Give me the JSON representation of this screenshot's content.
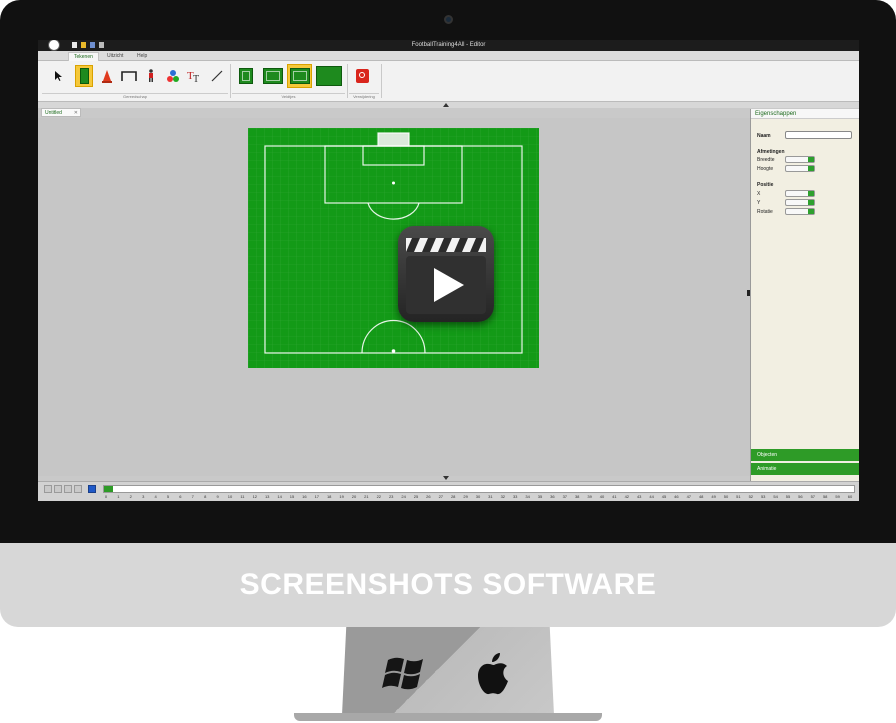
{
  "window": {
    "title": "FootballTraining4All - Editor"
  },
  "menu_tabs": [
    {
      "label": "Tekenen",
      "active": true
    },
    {
      "label": "Uitzicht",
      "active": false
    },
    {
      "label": "Help",
      "active": false
    }
  ],
  "ribbon": {
    "tools": [
      {
        "name": "select-arrow-icon"
      },
      {
        "name": "player-card-icon",
        "selected": true
      },
      {
        "name": "cone-icon"
      },
      {
        "name": "goal-icon"
      },
      {
        "name": "player-icon"
      },
      {
        "name": "shapes-icon"
      },
      {
        "name": "text-icon"
      },
      {
        "name": "line-icon"
      }
    ],
    "field_views": [
      {
        "name": "field-half-view",
        "selected": false
      },
      {
        "name": "field-full-view",
        "selected": false
      },
      {
        "name": "field-quarter-view",
        "selected": true
      },
      {
        "name": "field-blank-view",
        "selected": false
      }
    ],
    "groups": [
      "Gereedschap",
      "Veldtjes",
      "Verwijdering"
    ]
  },
  "document_tab": {
    "label": "Untitled"
  },
  "properties_panel": {
    "header": "Eigenschappen",
    "name_label": "Naam",
    "name_value": "",
    "dimensions_header": "Afmetingen",
    "width_label": "Breedte",
    "height_label": "Hoogte",
    "position_header": "Positie",
    "x_label": "X",
    "y_label": "Y",
    "rotation_label": "Rotatie"
  },
  "accordion": [
    "Objecten",
    "Animatie"
  ],
  "timeline": {
    "tick_labels": [
      "0",
      "1",
      "2",
      "3",
      "4",
      "5",
      "6",
      "7",
      "8",
      "9",
      "10",
      "11",
      "12",
      "13",
      "14",
      "15",
      "16",
      "17",
      "18",
      "19",
      "20",
      "21",
      "22",
      "23",
      "24",
      "25",
      "26",
      "27",
      "28",
      "29",
      "30",
      "31",
      "32",
      "33",
      "34",
      "35",
      "36",
      "37",
      "38",
      "39",
      "40",
      "41",
      "42",
      "43",
      "44",
      "45",
      "46",
      "47",
      "48",
      "49",
      "50",
      "51",
      "52",
      "53",
      "54",
      "55",
      "56",
      "57",
      "58",
      "59",
      "60"
    ],
    "progress_fraction": 0.012
  },
  "banner": {
    "text": "SCREENSHOTS SOFTWARE"
  },
  "platform_icons": [
    "windows-icon",
    "apple-icon"
  ],
  "colors": {
    "pitch": "#139a17",
    "accent": "#2e9b27",
    "highlight": "#f5c83a"
  }
}
